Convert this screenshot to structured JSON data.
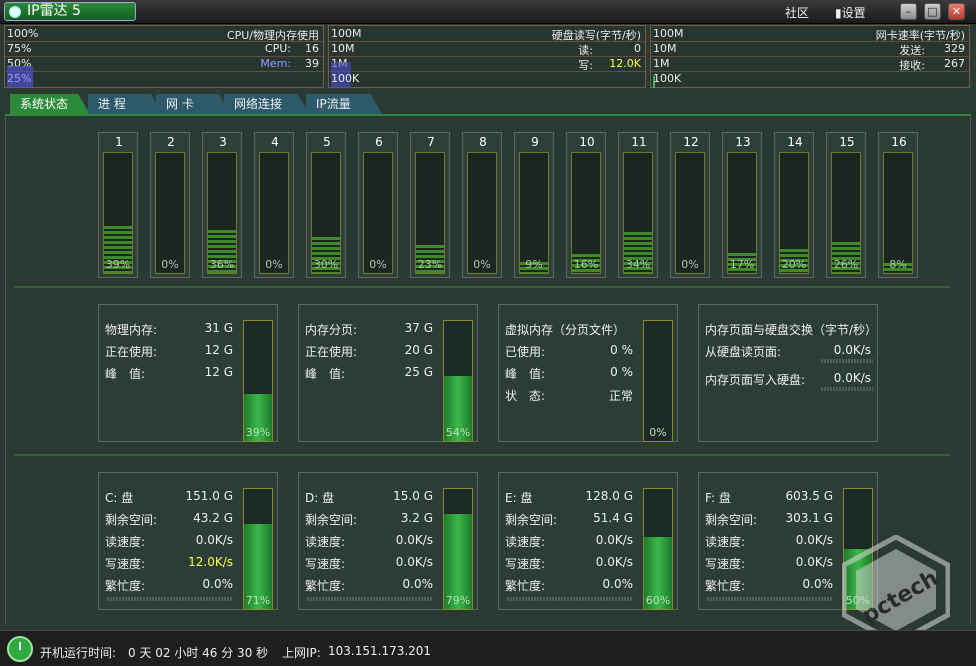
{
  "app": {
    "title": "IP雷达 5",
    "community": "社区",
    "settings": "设置"
  },
  "top": {
    "cpu": {
      "scale": [
        "100%",
        "75%",
        "50%",
        "25%"
      ],
      "title": "CPU/物理内存使用",
      "cpu_label": "CPU:",
      "cpu_val": "16",
      "mem_label": "Mem:",
      "mem_val": "39"
    },
    "disk": {
      "scale": [
        "100M",
        "10M",
        "1M",
        "100K"
      ],
      "title": "硬盘读写(字节/秒)",
      "read_label": "读:",
      "read_val": "0",
      "write_label": "写:",
      "write_val": "12.0K"
    },
    "net": {
      "scale": [
        "100M",
        "10M",
        "1M",
        "100K"
      ],
      "title": "网卡速率(字节/秒)",
      "send_label": "发送:",
      "send_val": "329",
      "recv_label": "接收:",
      "recv_val": "267"
    }
  },
  "tabs": [
    "系统状态",
    "进 程",
    "网 卡",
    "网络连接",
    "IP流量"
  ],
  "cpu_cores": [
    {
      "num": "1",
      "pct": "39%"
    },
    {
      "num": "2",
      "pct": "0%"
    },
    {
      "num": "3",
      "pct": "36%"
    },
    {
      "num": "4",
      "pct": "0%"
    },
    {
      "num": "5",
      "pct": "30%"
    },
    {
      "num": "6",
      "pct": "0%"
    },
    {
      "num": "7",
      "pct": "23%"
    },
    {
      "num": "8",
      "pct": "0%"
    },
    {
      "num": "9",
      "pct": "9%"
    },
    {
      "num": "10",
      "pct": "16%"
    },
    {
      "num": "11",
      "pct": "34%"
    },
    {
      "num": "12",
      "pct": "0%"
    },
    {
      "num": "13",
      "pct": "17%"
    },
    {
      "num": "14",
      "pct": "20%"
    },
    {
      "num": "15",
      "pct": "26%"
    },
    {
      "num": "16",
      "pct": "8%"
    }
  ],
  "memory": {
    "physical": {
      "rows": [
        {
          "label": "物理内存:",
          "value": "31 G"
        },
        {
          "label": "正在使用:",
          "value": "12 G"
        },
        {
          "label": "峰　值:",
          "value": "12 G"
        }
      ],
      "pct": "39%",
      "fill": 0.39
    },
    "paging": {
      "rows": [
        {
          "label": "内存分页:",
          "value": "37 G"
        },
        {
          "label": "正在使用:",
          "value": "20 G"
        },
        {
          "label": "峰　值:",
          "value": "25 G"
        }
      ],
      "pct": "54%",
      "fill": 0.54
    },
    "virtual": {
      "title": "虚拟内存（分页文件）",
      "rows": [
        {
          "label": "已使用:",
          "value": "0 %"
        },
        {
          "label": "峰　值:",
          "value": "0 %"
        },
        {
          "label": "状　态:",
          "value": "正常"
        }
      ],
      "pct": "0%",
      "fill": 0.0
    },
    "swap": {
      "title": "内存页面与硬盘交换（字节/秒）",
      "rows": [
        {
          "label": "从硬盘读页面:",
          "value": "0.0K/s"
        },
        {
          "label": "内存页面写入硬盘:",
          "value": "0.0K/s"
        }
      ]
    }
  },
  "disks": [
    {
      "name": "C: 盘",
      "total": "151.0 G",
      "free_label": "剩余空间:",
      "free": "43.2 G",
      "read_label": "读速度:",
      "read": "0.0K/s",
      "write_label": "写速度:",
      "write": "12.0K/s",
      "busy_label": "繁忙度:",
      "busy": "0.0%",
      "pct": "71%",
      "fill": 0.71
    },
    {
      "name": "D: 盘",
      "total": "15.0 G",
      "free_label": "剩余空间:",
      "free": "3.2 G",
      "read_label": "读速度:",
      "read": "0.0K/s",
      "write_label": "写速度:",
      "write": "0.0K/s",
      "busy_label": "繁忙度:",
      "busy": "0.0%",
      "pct": "79%",
      "fill": 0.79
    },
    {
      "name": "E: 盘",
      "total": "128.0 G",
      "free_label": "剩余空间:",
      "free": "51.4 G",
      "read_label": "读速度:",
      "read": "0.0K/s",
      "write_label": "写速度:",
      "write": "0.0K/s",
      "busy_label": "繁忙度:",
      "busy": "0.0%",
      "pct": "60%",
      "fill": 0.6
    },
    {
      "name": "F: 盘",
      "total": "603.5 G",
      "free_label": "剩余空间:",
      "free": "303.1 G",
      "read_label": "读速度:",
      "read": "0.0K/s",
      "write_label": "写速度:",
      "write": "0.0K/s",
      "busy_label": "繁忙度:",
      "busy": "0.0%",
      "pct": "50%",
      "fill": 0.5
    }
  ],
  "footer": {
    "uptime_label": "开机运行时间:",
    "uptime": "0 天 02 小时 46 分 30 秒",
    "ip_label": "上网IP:",
    "ip": "103.151.173.201"
  },
  "watermark": {
    "text": "pctech"
  },
  "colors": {
    "accent": "#2b8a3a",
    "warning": "#ffff50",
    "panel": "#2c3c36"
  }
}
